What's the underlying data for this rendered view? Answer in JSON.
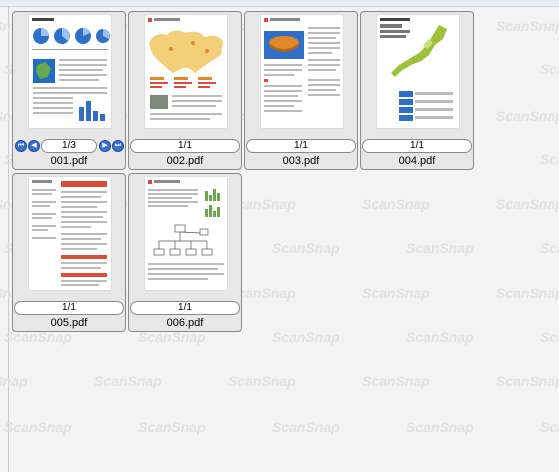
{
  "watermark": {
    "text": "ScanSnap"
  },
  "thumbnails": [
    {
      "filename": "001.pdf",
      "page": "1/3",
      "nav": true
    },
    {
      "filename": "002.pdf",
      "page": "1/1",
      "nav": false
    },
    {
      "filename": "003.pdf",
      "page": "1/1",
      "nav": false
    },
    {
      "filename": "004.pdf",
      "page": "1/1",
      "nav": false
    },
    {
      "filename": "005.pdf",
      "page": "1/1",
      "nav": false
    },
    {
      "filename": "006.pdf",
      "page": "1/1",
      "nav": false
    }
  ],
  "icons": {
    "first": "first-page-icon",
    "prev": "previous-page-icon",
    "next": "next-page-icon",
    "last": "last-page-icon"
  },
  "colors": {
    "background": "#f3f3f3",
    "nav_button": "#3b6fd0",
    "chart_blue": "#2e6fc7",
    "map_yellow": "#f3cf7a",
    "map_green": "#9dc23a",
    "table_red": "#d94b3b",
    "orange": "#e0882a"
  }
}
